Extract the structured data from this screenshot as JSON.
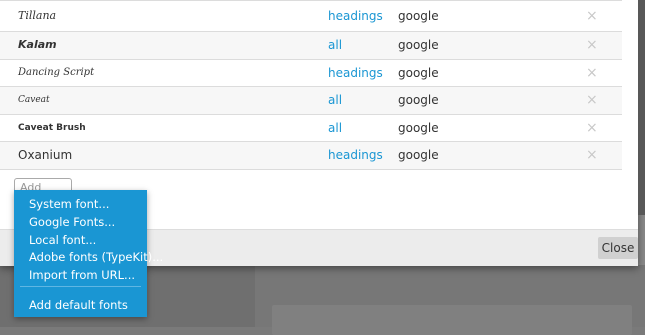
{
  "fonts": [
    {
      "name": "Tillana",
      "usage": "headings",
      "source": "google",
      "delete": "×"
    },
    {
      "name": "Kalam",
      "usage": "all",
      "source": "google",
      "delete": "×"
    },
    {
      "name": "Dancing Script",
      "usage": "headings",
      "source": "google",
      "delete": "×"
    },
    {
      "name": "Caveat",
      "usage": "all",
      "source": "google",
      "delete": "×"
    },
    {
      "name": "Caveat Brush",
      "usage": "all",
      "source": "google",
      "delete": "×"
    },
    {
      "name": "Oxanium",
      "usage": "headings",
      "source": "google",
      "delete": "×"
    }
  ],
  "add_font": {
    "label": "Add font..."
  },
  "menu": {
    "items": [
      "System font...",
      "Google Fonts...",
      "Local font...",
      "Adobe fonts (TypeKit)...",
      "Import from URL..."
    ],
    "default_item": "Add default fonts"
  },
  "footer": {
    "close_label": "Close"
  }
}
